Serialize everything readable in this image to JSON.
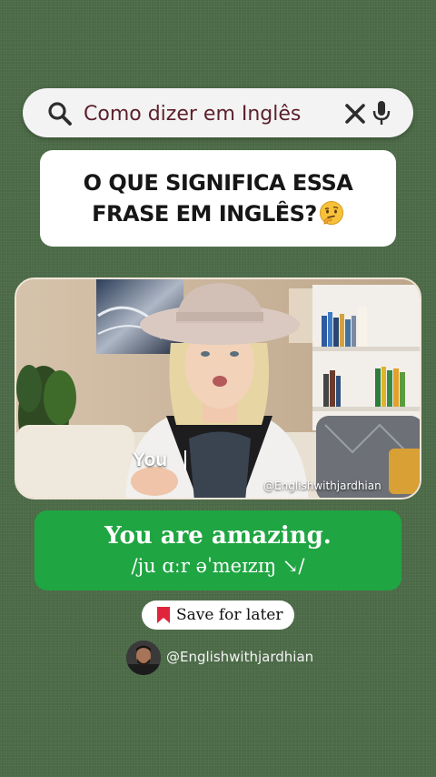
{
  "search": {
    "query": "Como dizer em Inglês",
    "icon": "search-icon",
    "clear_icon": "close-icon",
    "mic_icon": "microphone-icon"
  },
  "question": {
    "line1": "O QUE SIGNIFICA ESSA",
    "line2": "FRASE EM INGLÊS?",
    "emoji": "thinking-face-icon"
  },
  "video": {
    "caption": "You",
    "watermark": "@Englishwithjardhian"
  },
  "answer": {
    "phrase": "You are amazing.",
    "ipa": "/ju ɑːr əˈmeɪzɪŋ ↘/"
  },
  "save": {
    "label": "Save for later",
    "icon": "bookmark-icon"
  },
  "author": {
    "handle": "@Englishwithjardhian"
  },
  "colors": {
    "background": "#4c6a47",
    "answer_green": "#1fa542",
    "search_text": "#5c1f2b",
    "bookmark_red": "#e0243c"
  }
}
